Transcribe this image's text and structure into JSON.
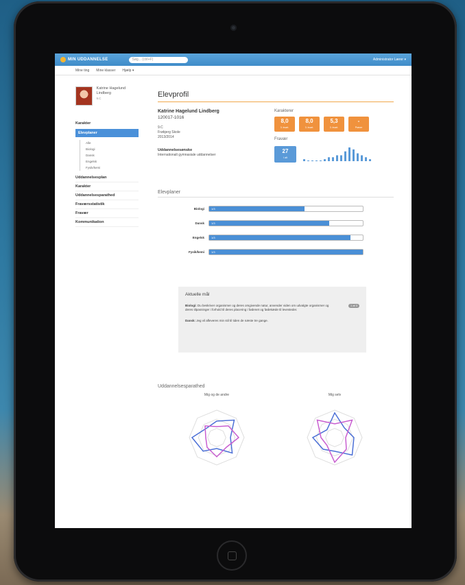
{
  "app": {
    "logo_text": "MIN UDDANNELSE",
    "search_placeholder": "Søg... (ctrl+F)",
    "user_menu": "Administrator Lærer ▾"
  },
  "subnav": [
    "Mine ting",
    "Mine klasser",
    "Hjælp ▾"
  ],
  "profile": {
    "name": "Katrine Hagelund Lindberg",
    "class": "9.C"
  },
  "sidebar": {
    "top_link": "Karakter",
    "active": "Elevplaner",
    "sub_items": [
      "Alle",
      "Biologi",
      "Dansk",
      "Engelsk",
      "Fysik/kemi"
    ],
    "links": [
      "Uddannelsesplan",
      "Karakter",
      "Uddannelsesparathed",
      "Fraværsstatistik",
      "Fravær",
      "Kommunikation"
    ]
  },
  "main": {
    "title": "Elevprofil",
    "student_name": "Katrine Hagelund Lindberg",
    "student_id": "120017-1016",
    "class_label": "9.C",
    "address_line": "Frøbjerg Skole",
    "year": "2013/2014",
    "edu_heading": "Uddannelsesønske",
    "edu_value": "Internationalt gymnasiale uddannelser",
    "grades_label": "Karakterer",
    "grades": [
      {
        "value": "8,0",
        "label": "3. kvart."
      },
      {
        "value": "8,0",
        "label": "3. kvart."
      },
      {
        "value": "5,3",
        "label": "3. kvart."
      },
      {
        "value": "-",
        "label": "Prøver"
      }
    ],
    "absence_label": "Fravær",
    "absence": {
      "value": "27",
      "label": "I alt"
    },
    "absence_trend": [
      1,
      0,
      0,
      0,
      0,
      1,
      2,
      2,
      3,
      3,
      5,
      7,
      6,
      4,
      3,
      2,
      1
    ]
  },
  "plans": {
    "heading": "Elevplaner",
    "bars": [
      {
        "label": "Biologi",
        "progress": 0.62,
        "text": "1/3"
      },
      {
        "label": "Dansk",
        "progress": 0.78,
        "text": "1/3"
      },
      {
        "label": "Engelsk",
        "progress": 0.92,
        "text": "1/3"
      },
      {
        "label": "Fysik/kemi",
        "progress": 1.0,
        "text": "1/3"
      }
    ]
  },
  "goals": {
    "heading": "Aktuelle mål",
    "items": [
      {
        "subject": "Biologi:",
        "text": "Du beskriver organismer og deres omgivende natur, anvender viden om udvalgte organismer og deres tilpasninger i forhold til deres placering i fødenet og fødekæde til levesteder.",
        "badge": "1 af 3"
      },
      {
        "subject": "Dansk:",
        "text": "Jeg vil afleveres min stil til tiden de næste tre gange."
      }
    ]
  },
  "development": {
    "heading": "Uddannelsesparathed",
    "radar_titles": [
      "Mig og de andre",
      "Mig selv"
    ]
  },
  "colors": {
    "accent": "#f0923d",
    "brand": "#4a90d9"
  }
}
